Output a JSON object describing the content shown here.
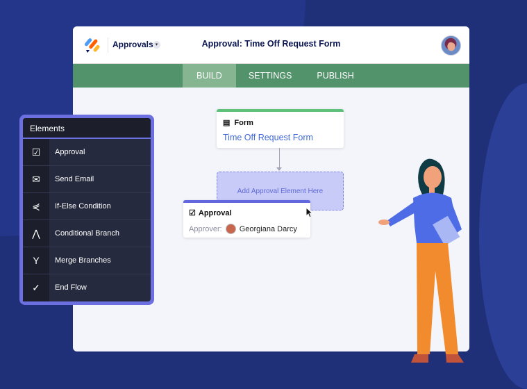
{
  "header": {
    "app_name": "Approvals",
    "title": "Approval: Time Off Request Form"
  },
  "nav": {
    "tabs": [
      {
        "label": "BUILD",
        "active": true
      },
      {
        "label": "SETTINGS"
      },
      {
        "label": "PUBLISH"
      }
    ]
  },
  "canvas": {
    "form_card": {
      "heading": "Form",
      "link": "Time Off Request Form"
    },
    "dropzone": "Add Approval Element Here",
    "approval_card": {
      "heading": "Approval",
      "approver_label": "Approver:",
      "approver_name": "Georgiana Darcy"
    }
  },
  "elements": {
    "title": "Elements",
    "items": [
      {
        "label": "Approval",
        "icon": "approval-icon"
      },
      {
        "label": "Send Email",
        "icon": "envelope-icon"
      },
      {
        "label": "If-Else Condition",
        "icon": "condition-icon"
      },
      {
        "label": "Conditional Branch",
        "icon": "branch-icon"
      },
      {
        "label": "Merge Branches",
        "icon": "merge-icon"
      },
      {
        "label": "End Flow",
        "icon": "check-circle-icon"
      }
    ]
  },
  "colors": {
    "accent": "#6b6fe0",
    "nav": "#53936c",
    "form_bar": "#5ec17a",
    "link": "#3f68d7"
  }
}
